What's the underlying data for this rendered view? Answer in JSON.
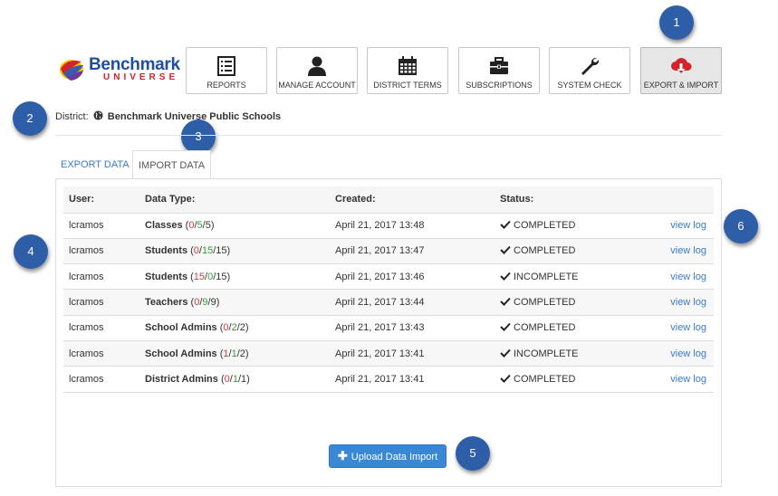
{
  "logo": {
    "text": "Benchmark",
    "subtext": "UNIVERSE"
  },
  "nav": [
    {
      "label": "REPORTS",
      "icon": "reports-icon"
    },
    {
      "label": "MANAGE ACCOUNT",
      "icon": "user-icon"
    },
    {
      "label": "DISTRICT TERMS",
      "icon": "calendar-icon"
    },
    {
      "label": "SUBSCRIPTIONS",
      "icon": "briefcase-icon"
    },
    {
      "label": "SYSTEM CHECK",
      "icon": "wrench-icon"
    },
    {
      "label": "EXPORT & IMPORT",
      "icon": "cloud-download-icon",
      "active": true
    }
  ],
  "district": {
    "label": "District:",
    "name": "Benchmark Universe Public Schools"
  },
  "tabs": [
    {
      "label": "EXPORT DATA"
    },
    {
      "label": "IMPORT DATA",
      "active": true
    }
  ],
  "table": {
    "headers": [
      "User:",
      "Data Type:",
      "Created:",
      "Status:"
    ],
    "rows": [
      {
        "user": "lcramos",
        "type": "Classes",
        "c1": "0",
        "c2": "5",
        "c3": "5",
        "created": "April 21, 2017 13:48",
        "status": "COMPLETED",
        "log": "view log"
      },
      {
        "user": "lcramos",
        "type": "Students",
        "c1": "0",
        "c2": "15",
        "c3": "15",
        "created": "April 21, 2017 13:47",
        "status": "COMPLETED",
        "log": "view log"
      },
      {
        "user": "lcramos",
        "type": "Students",
        "c1": "15",
        "c2": "0",
        "c3": "15",
        "created": "April 21, 2017 13:46",
        "status": "INCOMPLETE",
        "log": "view log"
      },
      {
        "user": "lcramos",
        "type": "Teachers",
        "c1": "0",
        "c2": "9",
        "c3": "9",
        "created": "April 21, 2017 13:44",
        "status": "COMPLETED",
        "log": "view log"
      },
      {
        "user": "lcramos",
        "type": "School Admins",
        "c1": "0",
        "c2": "2",
        "c3": "2",
        "created": "April 21, 2017 13:43",
        "status": "COMPLETED",
        "log": "view log"
      },
      {
        "user": "lcramos",
        "type": "School Admins",
        "c1": "1",
        "c2": "1",
        "c3": "2",
        "created": "April 21, 2017 13:41",
        "status": "INCOMPLETE",
        "log": "view log"
      },
      {
        "user": "lcramos",
        "type": "District Admins",
        "c1": "0",
        "c2": "1",
        "c3": "1",
        "created": "April 21, 2017 13:41",
        "status": "COMPLETED",
        "log": "view log"
      }
    ]
  },
  "upload": {
    "label": "Upload Data Import"
  },
  "callouts": [
    "1",
    "2",
    "3",
    "4",
    "5",
    "6"
  ],
  "colors": {
    "accent": "#3a87d4",
    "callout": "#2f5ea8",
    "error": "#d23a3a",
    "success": "#3a9a3a",
    "brand": "#1f4e9c"
  }
}
